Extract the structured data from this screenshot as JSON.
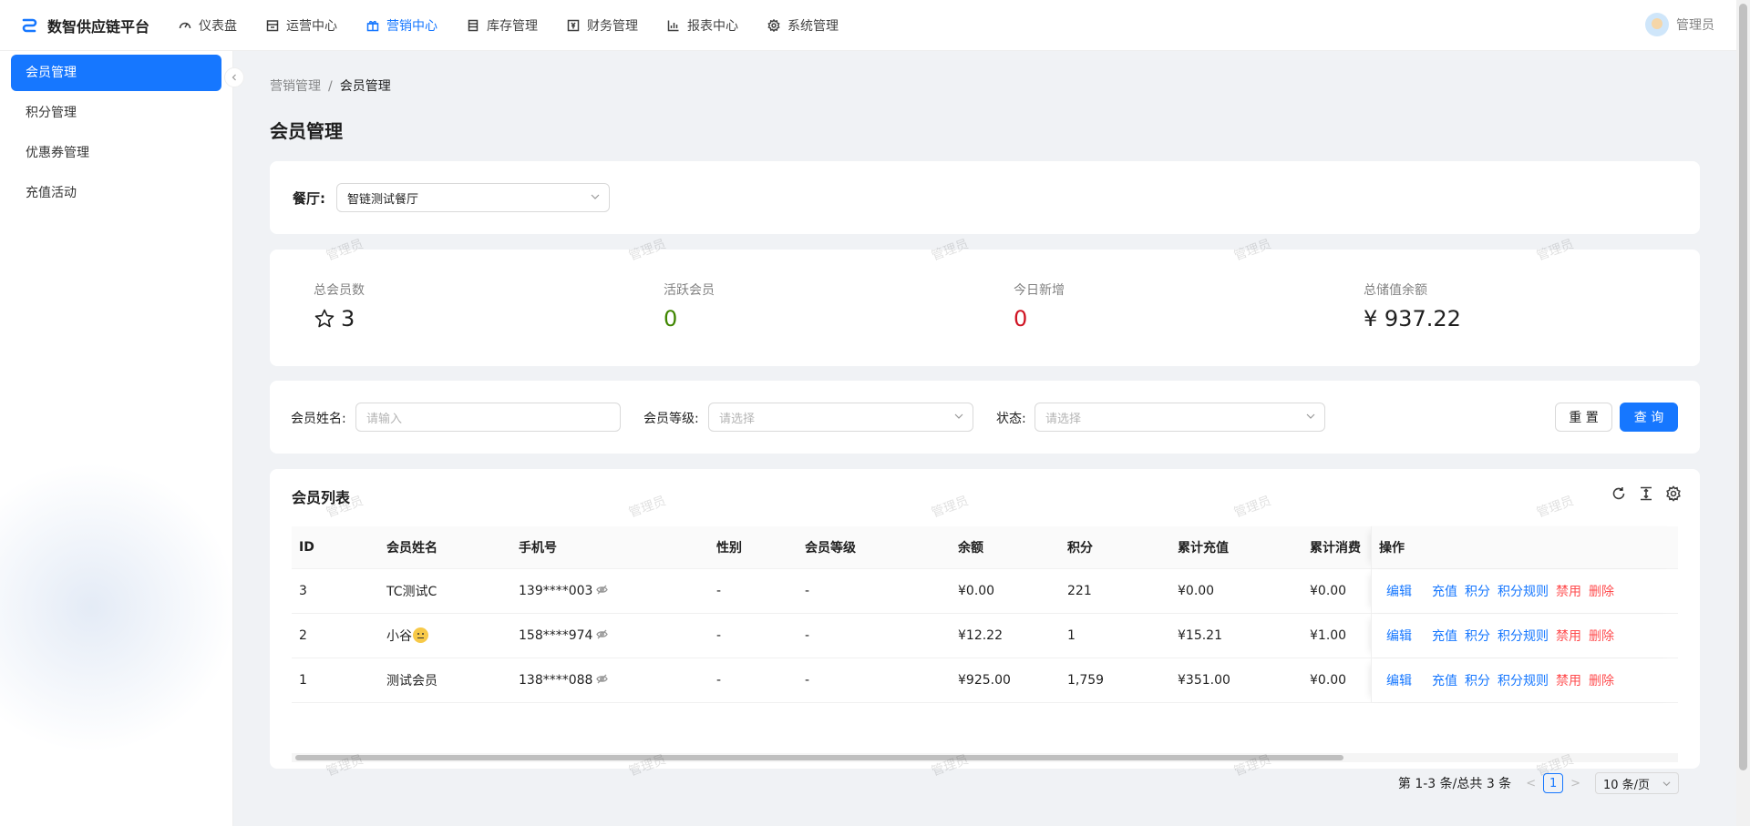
{
  "app": {
    "title": "数智供应链平台"
  },
  "nav": [
    {
      "label": "仪表盘",
      "icon": "dashboard-icon"
    },
    {
      "label": "运营中心",
      "icon": "store-icon"
    },
    {
      "label": "营销中心",
      "icon": "gift-icon",
      "active": true
    },
    {
      "label": "库存管理",
      "icon": "database-icon"
    },
    {
      "label": "财务管理",
      "icon": "finance-icon"
    },
    {
      "label": "报表中心",
      "icon": "bar-chart-icon"
    },
    {
      "label": "系统管理",
      "icon": "gear-icon"
    }
  ],
  "user": {
    "name": "管理员"
  },
  "sidebar": {
    "items": [
      {
        "label": "会员管理",
        "active": true
      },
      {
        "label": "积分管理"
      },
      {
        "label": "优惠券管理"
      },
      {
        "label": "充值活动"
      }
    ]
  },
  "breadcrumb": {
    "parent": "营销管理",
    "separator": "/",
    "current": "会员管理"
  },
  "page": {
    "title": "会员管理"
  },
  "restaurant": {
    "label": "餐厅:",
    "value": "智链测试餐厅"
  },
  "stats": [
    {
      "label": "总会员数",
      "value": "3",
      "color": "#1f1f1f",
      "icon": "star-icon"
    },
    {
      "label": "活跃会员",
      "value": "0",
      "color": "#3f8600"
    },
    {
      "label": "今日新增",
      "value": "0",
      "color": "#cf1322"
    },
    {
      "label": "总储值余额",
      "value": "¥ 937.22",
      "color": "#1f1f1f"
    }
  ],
  "filter": {
    "name_label": "会员姓名:",
    "name_placeholder": "请输入",
    "level_label": "会员等级:",
    "level_placeholder": "请选择",
    "status_label": "状态:",
    "status_placeholder": "请选择",
    "reset_label": "重 置",
    "query_label": "查 询"
  },
  "table": {
    "title": "会员列表",
    "columns": [
      "ID",
      "会员姓名",
      "手机号",
      "性别",
      "会员等级",
      "余额",
      "积分",
      "累计充值",
      "累计消费",
      "操作"
    ],
    "rows": [
      {
        "id": "3",
        "name": "TC测试C",
        "emoji": false,
        "phone": "139****003",
        "sex": "-",
        "level": "-",
        "balance": "¥0.00",
        "points": "221",
        "recharge": "¥0.00",
        "consume": "¥0.00"
      },
      {
        "id": "2",
        "name": "小谷",
        "emoji": true,
        "phone": "158****974",
        "sex": "-",
        "level": "-",
        "balance": "¥12.22",
        "points": "1",
        "recharge": "¥15.21",
        "consume": "¥1.00"
      },
      {
        "id": "1",
        "name": "测试会员",
        "emoji": false,
        "phone": "138****088",
        "sex": "-",
        "level": "-",
        "balance": "¥925.00",
        "points": "1,759",
        "recharge": "¥351.00",
        "consume": "¥0.00"
      }
    ],
    "actions": [
      "编辑",
      "充值",
      "积分",
      "积分规则",
      "禁用",
      "删除"
    ]
  },
  "pagination": {
    "summary": "第 1-3 条/总共 3 条",
    "current": "1",
    "page_size": "10 条/页"
  },
  "watermark": "管理员",
  "colors": {
    "primary": "#1677ff",
    "danger": "#ff4d4f",
    "success": "#3f8600",
    "error": "#cf1322"
  }
}
